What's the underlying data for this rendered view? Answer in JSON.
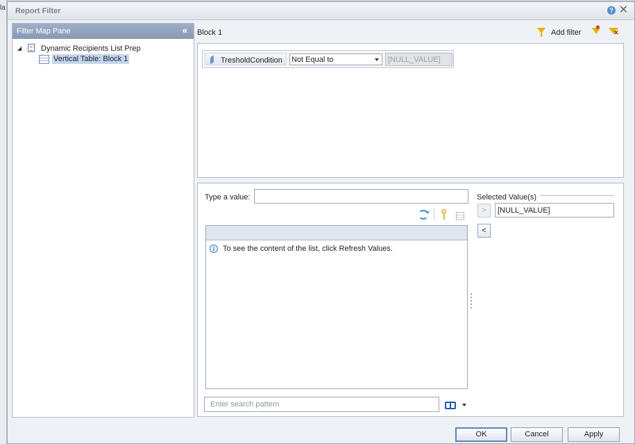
{
  "background": {
    "edge_text": "la"
  },
  "dialog": {
    "title": "Report Filter",
    "help_label": "?",
    "close_label": "✕"
  },
  "filter_map_pane": {
    "title": "Filter Map Pane",
    "collapse_label": "«",
    "tree": {
      "root_label": "Dynamic Recipients List Prep",
      "child_label": "Vertical Table: Block 1"
    }
  },
  "block": {
    "label": "Block 1",
    "add_filter_label": "Add filter"
  },
  "filter": {
    "object_label": "TresholdCondition",
    "operator": "Not Equal to",
    "operand": "[NULL_VALUE]"
  },
  "value_panel": {
    "type_value_label": "Type a value:",
    "type_value": "",
    "info_text": "To see the content of the list, click Refresh Values.",
    "search_placeholder": "Enter search pattern",
    "selected_values_label": "Selected Value(s)",
    "move_right_label": ">",
    "move_left_label": "<",
    "selected_values": [
      "[NULL_VALUE]"
    ]
  },
  "buttons": {
    "ok": "OK",
    "cancel": "Cancel",
    "apply": "Apply"
  }
}
